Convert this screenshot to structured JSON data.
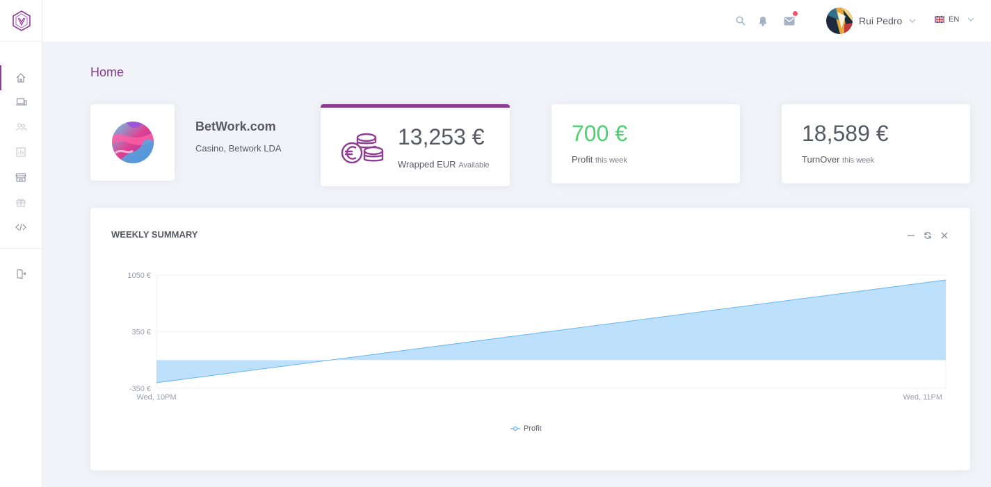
{
  "topbar": {
    "user_name": "Rui Pedro",
    "language": "EN"
  },
  "sidebar": {
    "items": [
      {
        "icon": "home-icon",
        "active": true
      },
      {
        "icon": "devices-icon"
      },
      {
        "icon": "users-icon"
      },
      {
        "icon": "chart-icon"
      },
      {
        "icon": "store-icon"
      },
      {
        "icon": "gift-icon"
      },
      {
        "icon": "code-icon"
      },
      {
        "icon": "logout-icon"
      }
    ]
  },
  "page": {
    "title": "Home"
  },
  "company": {
    "name": "BetWork.com",
    "subtitle": "Casino, Betwork LDA"
  },
  "wallet": {
    "amount": "13,253 €",
    "label": "Wrapped EUR",
    "status": "Available"
  },
  "profit": {
    "value": "700 €",
    "label": "Profit",
    "period": "this week",
    "color": "#34bfa3"
  },
  "turnover": {
    "value": "18,589 €",
    "label": "TurnOver",
    "period": "this week"
  },
  "summary": {
    "title": "WEEKLY SUMMARY"
  },
  "chart_data": {
    "type": "area",
    "x": [
      "Wed, 10PM",
      "Wed, 11PM"
    ],
    "series": [
      {
        "name": "Profit",
        "values": [
          -280,
          990
        ]
      }
    ],
    "yticks": [
      "1050 €",
      "350 €",
      "-350 €"
    ],
    "ylim": [
      -350,
      1050
    ],
    "baseline": 0,
    "fill": "#bde0fc",
    "stroke": "#6ab4f0",
    "legend": "bottom-center"
  },
  "colors": {
    "accent": "#8e3d93"
  }
}
